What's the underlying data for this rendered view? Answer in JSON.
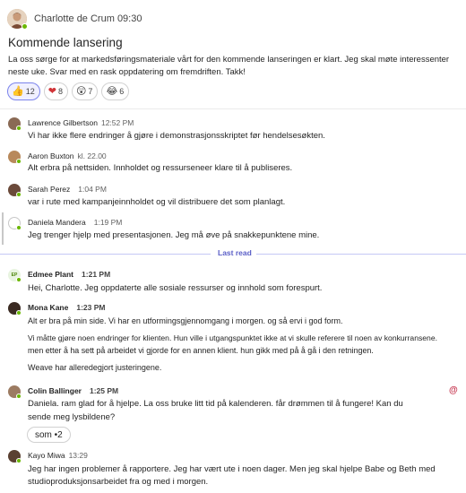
{
  "post": {
    "author": "Charlotte de Crum",
    "time": "09:30",
    "title": "Kommende lansering",
    "body_line1": "La oss sørge for at markedsføringsmateriale vårt for den kommende lanseringen er klart. Jeg skal møte interessenter",
    "body_line2": "neste uke. Svar med en rask oppdatering om fremdriften. Takk!",
    "reactions": [
      {
        "emoji": "👍",
        "count": "12",
        "icon": "thumbs-up-icon"
      },
      {
        "emoji": "❤",
        "count": "8",
        "icon": "heart-icon"
      },
      {
        "emoji": "😲",
        "count": "7",
        "icon": "surprised-icon"
      },
      {
        "emoji": "😂",
        "count": "6",
        "icon": "laugh-icon"
      }
    ]
  },
  "replies": [
    {
      "name": "Lawrence Gilbertson",
      "time": "12:52 PM",
      "lines": [
        "Vi har ikke flere endringer å gjøre i demonstrasjonsskriptet før hendelsesøkten."
      ],
      "avatar_color": "#8a6a55"
    },
    {
      "name": "Aaron Buxton",
      "time": "kl. 22.00",
      "lines": [
        "Alt erbra på nettsiden. Innholdet og ressurseneer klare til å publiseres."
      ],
      "avatar_color": "#b8895b"
    },
    {
      "name": "Sarah Perez",
      "time": "1:04 PM",
      "lines": [
        "var i rute med kampanjeinnholdet og vil distribuere det som planlagt."
      ],
      "avatar_color": "#6b4a3a"
    },
    {
      "name": "Daniela Mandera",
      "time": "1:19 PM",
      "lines": [
        "Jeg trenger hjelp med presentasjonen. Jeg må øve på snakkepunktene mine."
      ],
      "avatar_color": "#ffffff"
    },
    {
      "name": "Edmee Plant",
      "time": "1:21 PM",
      "initials": "EP",
      "lines": [
        "Hei, Charlotte. Jeg oppdaterte alle sosiale ressurser og innhold som forespurt."
      ],
      "avatar_color": "#e8f4e0"
    },
    {
      "name": "Mona Kane",
      "time": "1:23 PM",
      "lines": [
        "Alt er bra på min side. Vi har en utformingsgjennomgang i morgen. og så ervi i god form.",
        "Vi måtte gjøre noen endringer for klienten. Hun ville i utgangspunktet ikke at vi skulle referere til noen av konkurransene.",
        "men etter å ha sett på arbeidet vi gjorde for en annen klient. hun gikk med på å gå i den retningen.",
        "Weave har alleredegjort justeringene."
      ],
      "avatar_color": "#3a2a22"
    },
    {
      "name": "Colin Ballinger",
      "time": "1:25 PM",
      "lines": [
        "Daniela. ram glad for å hjelpe. La oss bruke litt tid på kalenderen. får drømmen til å fungere! Kan du",
        "sende meg lysbildene?"
      ],
      "avatar_color": "#9c7b62"
    },
    {
      "name": "Kayo Miwa",
      "time": "13:29",
      "lines": [
        "Jeg har ingen problemer å rapportere. Jeg har vært ute i noen dager. Men jeg skal hjelpe Babe og Beth med",
        "studioproduksjonsarbeidet fra og med i morgen."
      ],
      "avatar_color": "#5a4032"
    }
  ],
  "last_read_label": "Last read",
  "mention_symbol": "@",
  "inline_reaction": "som •2",
  "colors": {
    "accent": "#5b5fc7",
    "presence": "#6bb700",
    "mention": "#c4314b"
  }
}
